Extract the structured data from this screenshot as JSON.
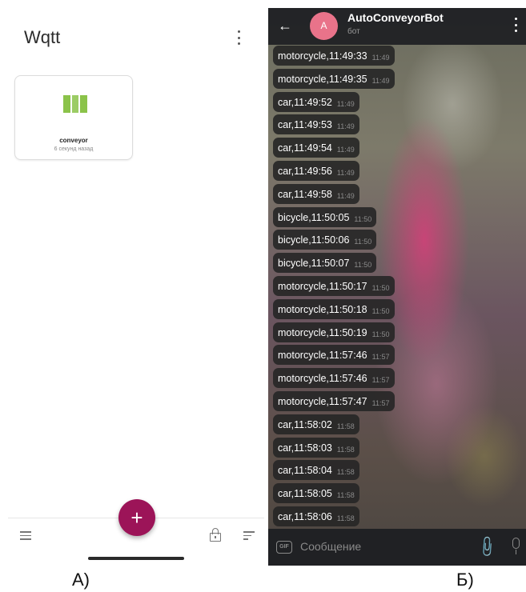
{
  "panel_a": {
    "title": "Wqtt",
    "card": {
      "name": "conveyor",
      "time": "6 секунд назад",
      "icon": "conveyor-icon"
    },
    "fab_label": "+",
    "label": "А)"
  },
  "panel_b": {
    "bot_name": "AutoConveyorBot",
    "bot_status": "бот",
    "avatar_letter": "A",
    "input_placeholder": "Сообщение",
    "gif_label": "GIF",
    "label": "Б)",
    "messages": [
      {
        "text": "motorcycle,11:49:33",
        "time": "11:49"
      },
      {
        "text": "motorcycle,11:49:35",
        "time": "11:49"
      },
      {
        "text": "car,11:49:52",
        "time": "11:49"
      },
      {
        "text": "car,11:49:53",
        "time": "11:49"
      },
      {
        "text": "car,11:49:54",
        "time": "11:49"
      },
      {
        "text": "car,11:49:56",
        "time": "11:49"
      },
      {
        "text": "car,11:49:58",
        "time": "11:49"
      },
      {
        "text": "bicycle,11:50:05",
        "time": "11:50"
      },
      {
        "text": "bicycle,11:50:06",
        "time": "11:50"
      },
      {
        "text": "bicycle,11:50:07",
        "time": "11:50"
      },
      {
        "text": "motorcycle,11:50:17",
        "time": "11:50"
      },
      {
        "text": "motorcycle,11:50:18",
        "time": "11:50"
      },
      {
        "text": "motorcycle,11:50:19",
        "time": "11:50"
      },
      {
        "text": "motorcycle,11:57:46",
        "time": "11:57"
      },
      {
        "text": "motorcycle,11:57:46",
        "time": "11:57"
      },
      {
        "text": "motorcycle,11:57:47",
        "time": "11:57"
      },
      {
        "text": "car,11:58:02",
        "time": "11:58"
      },
      {
        "text": "car,11:58:03",
        "time": "11:58"
      },
      {
        "text": "car,11:58:04",
        "time": "11:58"
      },
      {
        "text": "car,11:58:05",
        "time": "11:58"
      },
      {
        "text": "car,11:58:06",
        "time": "11:58"
      }
    ]
  }
}
